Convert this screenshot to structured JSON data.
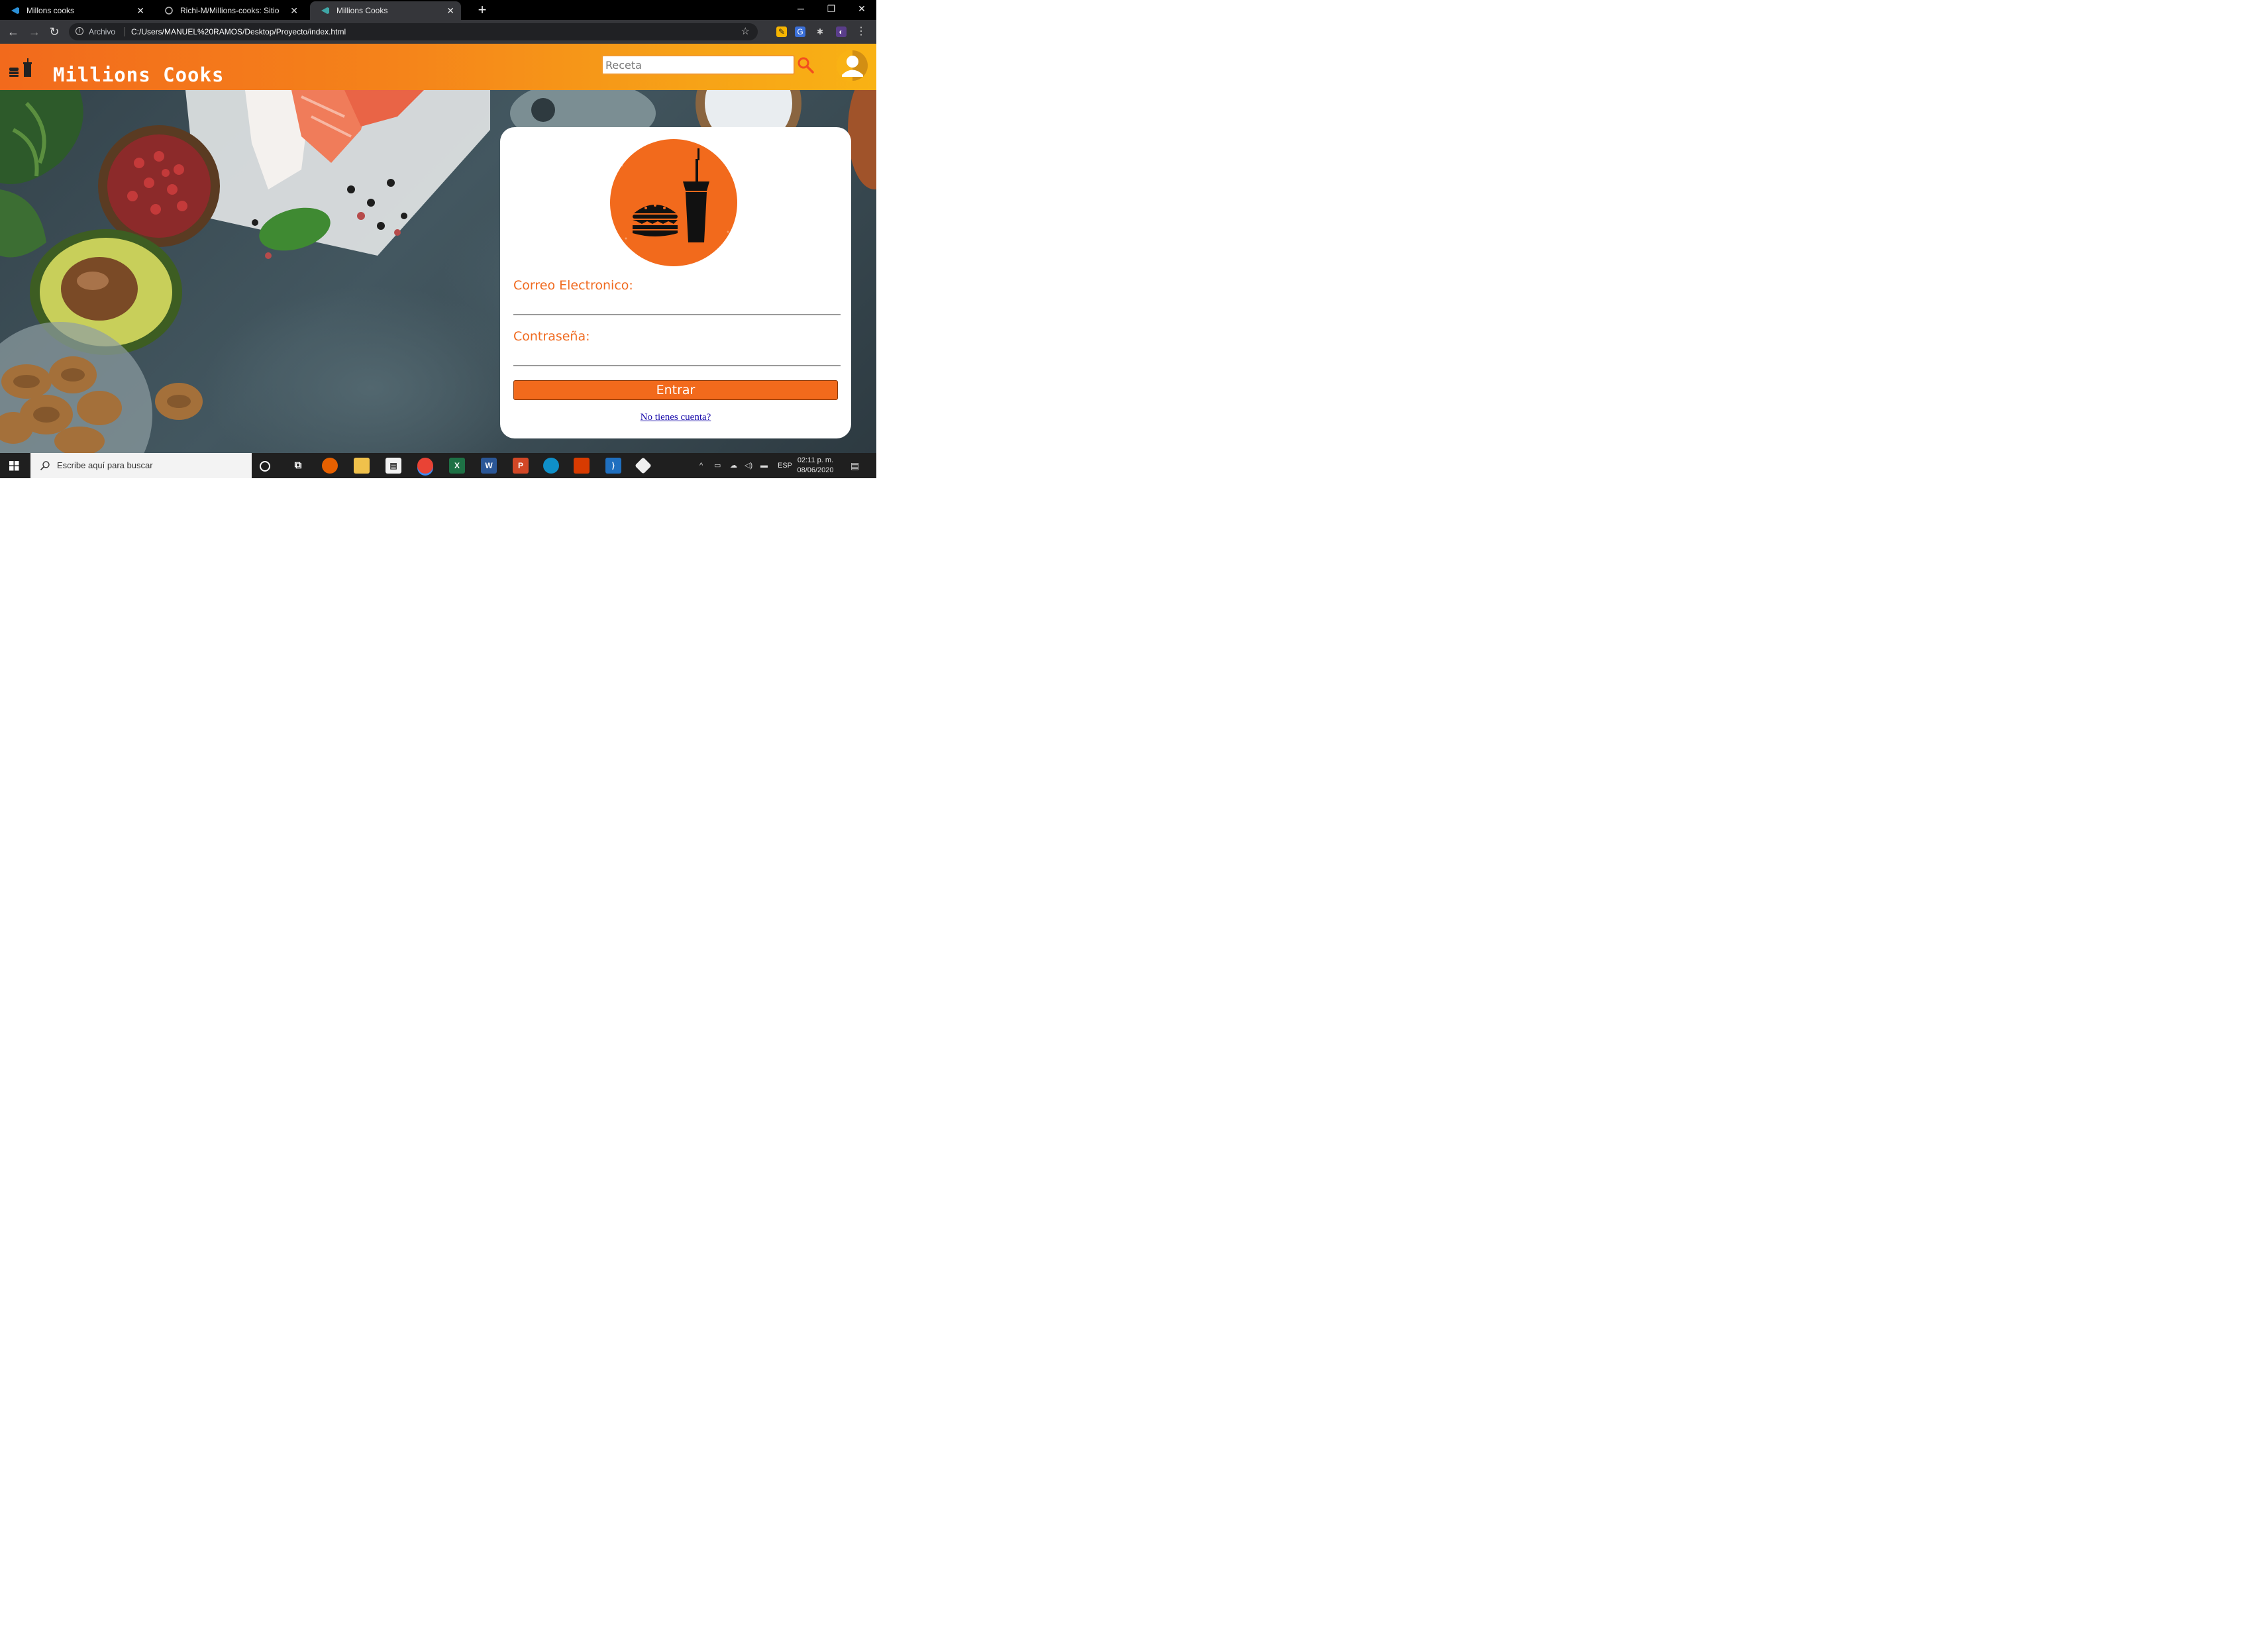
{
  "browser": {
    "tabs": [
      {
        "label": "Millons cooks",
        "active": false
      },
      {
        "label": "Richi-M/Millions-cooks: Sitio we",
        "active": false
      },
      {
        "label": "Millions Cooks",
        "active": true
      }
    ],
    "new_tab_glyph": "+",
    "window_controls": {
      "minimize": "─",
      "restore": "❐",
      "close": "✕"
    },
    "address": {
      "scheme_label": "Archivo",
      "url": "C:/Users/MANUEL%20RAMOS/Desktop/Proyecto/index.html"
    },
    "icons": [
      "back-icon",
      "forward-icon",
      "reload-icon",
      "info-icon",
      "star-icon",
      "puzzle-icon",
      "menu-icon"
    ]
  },
  "site": {
    "title": "Millions Cooks",
    "search": {
      "placeholder": "Receta",
      "value": ""
    },
    "colors": {
      "header_start": "#f26a1c",
      "header_end": "#f9b214",
      "accent": "#f26a1c"
    }
  },
  "login": {
    "email_label": "Correo Electronico:",
    "email_value": "",
    "password_label": "Contraseña:",
    "password_value": "",
    "submit_label": "Entrar",
    "register_link": "No tienes cuenta?"
  },
  "taskbar": {
    "search_placeholder": "Escribe aquí para buscar",
    "language": "ESP",
    "time": "02:11 p. m.",
    "date": "08/06/2020",
    "apps": [
      "cortana-icon",
      "task-view-icon",
      "firefox-icon",
      "file-explorer-icon",
      "store-icon",
      "chrome-icon",
      "excel-icon",
      "word-icon",
      "powerpoint-icon",
      "edge-icon",
      "office-icon",
      "vscode-icon",
      "git-icon"
    ]
  }
}
